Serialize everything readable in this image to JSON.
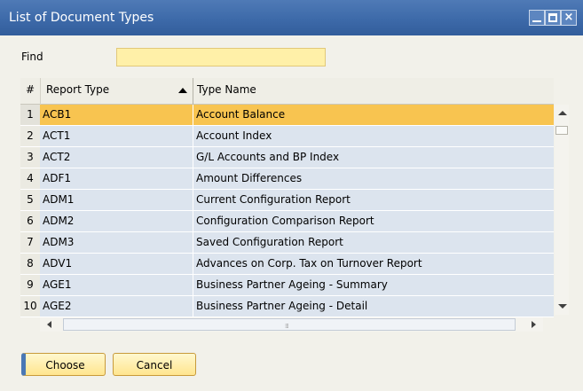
{
  "window": {
    "title": "List of Document Types"
  },
  "find": {
    "label": "Find",
    "value": ""
  },
  "table": {
    "columns": [
      "#",
      "Report Type",
      "Type Name"
    ],
    "sort_column": "Report Type",
    "sort_direction": "ascending",
    "selected_row": 1,
    "rows": [
      {
        "num": "1",
        "report_type": "ACB1",
        "type_name": "Account Balance"
      },
      {
        "num": "2",
        "report_type": "ACT1",
        "type_name": "Account Index"
      },
      {
        "num": "3",
        "report_type": "ACT2",
        "type_name": "G/L Accounts and BP Index"
      },
      {
        "num": "4",
        "report_type": "ADF1",
        "type_name": "Amount Differences"
      },
      {
        "num": "5",
        "report_type": "ADM1",
        "type_name": "Current Configuration Report"
      },
      {
        "num": "6",
        "report_type": "ADM2",
        "type_name": "Configuration Comparison Report"
      },
      {
        "num": "7",
        "report_type": "ADM3",
        "type_name": "Saved Configuration Report"
      },
      {
        "num": "8",
        "report_type": "ADV1",
        "type_name": "Advances on Corp. Tax on Turnover Report"
      },
      {
        "num": "9",
        "report_type": "AGE1",
        "type_name": "Business Partner Ageing - Summary"
      },
      {
        "num": "10",
        "report_type": "AGE2",
        "type_name": "Business Partner Ageing - Detail"
      }
    ]
  },
  "buttons": {
    "choose": "Choose",
    "cancel": "Cancel"
  },
  "colors": {
    "titlebar": "#3d6aa9",
    "selected_row": "#f8c450",
    "row_background": "#dce4ee",
    "find_input": "#fff0a8",
    "button": "#ffe58e"
  }
}
